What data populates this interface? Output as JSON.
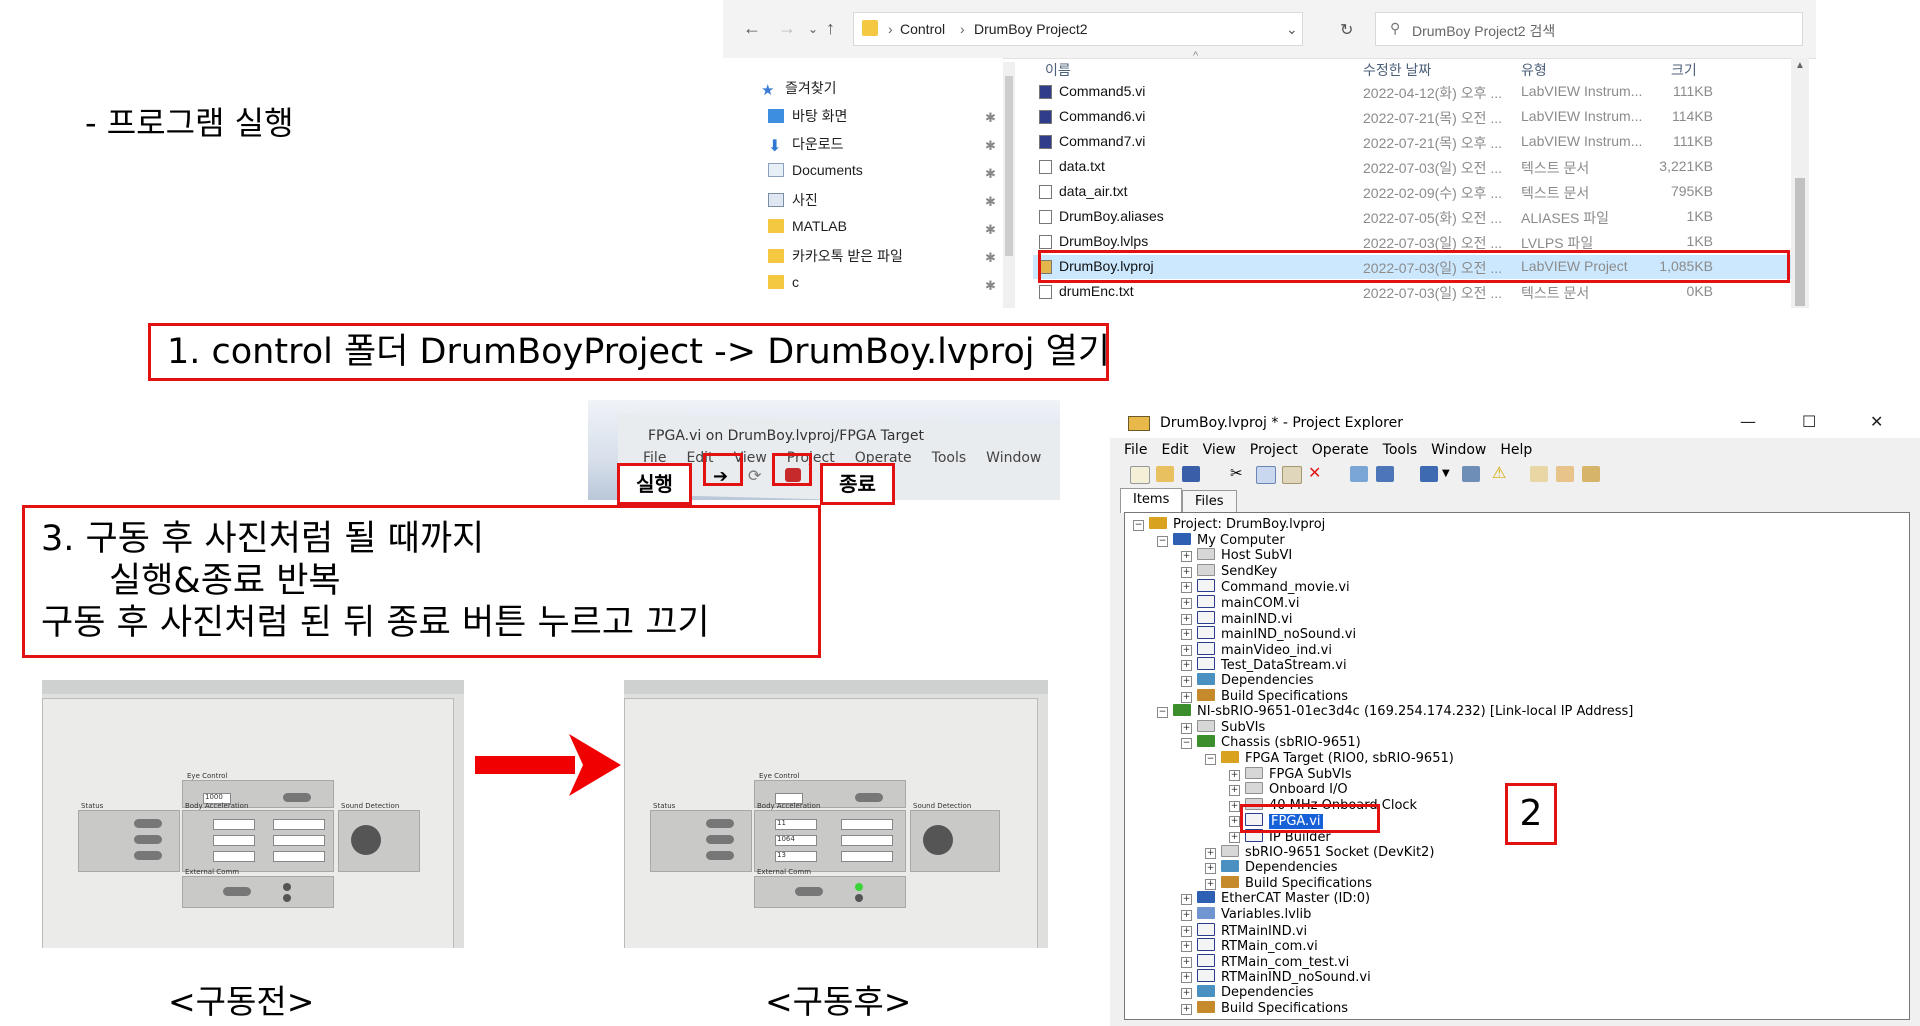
{
  "slide": {
    "heading": "- 프로그램 실행",
    "step1": "1. control 폴더 DrumBoyProject -> DrumBoy.lvproj 열기",
    "step3_lines": [
      "3. 구동 후 사진처럼 될 때까지",
      "실행&종료 반복",
      "구동 후 사진처럼 된 뒤 종료 버튼 누르고 끄기"
    ],
    "step2_label": "2",
    "caption_before": "<구동전>",
    "caption_after": "<구동후>",
    "accent_color": "#e31212"
  },
  "explorer": {
    "path": [
      "Control",
      "DrumBoy Project2"
    ],
    "search_placeholder": "DrumBoy Project2 검색",
    "sort_column": "이름",
    "columns": [
      "이름",
      "수정한 날짜",
      "유형",
      "크기"
    ],
    "nav_items": [
      {
        "label": "즐겨찾기",
        "icon": "star-icon"
      },
      {
        "label": "바탕 화면",
        "icon": "desktop-icon"
      },
      {
        "label": "다운로드",
        "icon": "download-icon"
      },
      {
        "label": "Documents",
        "icon": "document-icon"
      },
      {
        "label": "사진",
        "icon": "picture-icon"
      },
      {
        "label": "MATLAB",
        "icon": "folder-icon"
      },
      {
        "label": "카카오톡 받은 파일",
        "icon": "folder-icon"
      },
      {
        "label": "c",
        "icon": "folder-icon"
      }
    ],
    "files": [
      {
        "name": "Command5.vi",
        "date": "2022-04-12(화) 오후 ...",
        "type": "LabVIEW Instrum...",
        "size": "111KB",
        "icon": "labview-vi-icon"
      },
      {
        "name": "Command6.vi",
        "date": "2022-07-21(목) 오전 ...",
        "type": "LabVIEW Instrum...",
        "size": "114KB",
        "icon": "labview-vi-icon"
      },
      {
        "name": "Command7.vi",
        "date": "2022-07-21(목) 오후 ...",
        "type": "LabVIEW Instrum...",
        "size": "111KB",
        "icon": "labview-vi-icon"
      },
      {
        "name": "data.txt",
        "date": "2022-07-03(일) 오전 ...",
        "type": "텍스트 문서",
        "size": "3,221KB",
        "icon": "text-file-icon"
      },
      {
        "name": "data_air.txt",
        "date": "2022-02-09(수) 오후 ...",
        "type": "텍스트 문서",
        "size": "795KB",
        "icon": "text-file-icon"
      },
      {
        "name": "DrumBoy.aliases",
        "date": "2022-07-05(화) 오전 ...",
        "type": "ALIASES 파일",
        "size": "1KB",
        "icon": "file-icon"
      },
      {
        "name": "DrumBoy.lvlps",
        "date": "2022-07-03(일) 오전 ...",
        "type": "LVLPS 파일",
        "size": "1KB",
        "icon": "file-icon"
      },
      {
        "name": "DrumBoy.lvproj",
        "date": "2022-07-03(일) 오전 ...",
        "type": "LabVIEW Project",
        "size": "1,085KB",
        "icon": "labview-project-icon"
      },
      {
        "name": "drumEnc.txt",
        "date": "2022-07-03(일) 오전 ...",
        "type": "텍스트 문서",
        "size": "0KB",
        "icon": "text-file-icon"
      }
    ],
    "highlighted_file": "DrumBoy.lvproj"
  },
  "toolbar_photo": {
    "title": "FPGA.vi on DrumBoy.lvproj/FPGA Target",
    "menu": [
      "File",
      "Edit",
      "View",
      "Project",
      "Operate",
      "Tools",
      "Window"
    ],
    "run_label": "실행",
    "stop_label": "종료"
  },
  "panel_photos": {
    "labels": [
      "Eye Control",
      "Status",
      "Body Acceleration",
      "Sound Detection",
      "External Comm"
    ],
    "before_values": [
      "1000",
      "0",
      "0",
      "0"
    ],
    "after_values": [
      "11",
      "1064",
      "13"
    ]
  },
  "project_explorer": {
    "title": "DrumBoy.lvproj * - Project Explorer",
    "menu": [
      "File",
      "Edit",
      "View",
      "Project",
      "Operate",
      "Tools",
      "Window",
      "Help"
    ],
    "tabs": [
      "Items",
      "Files"
    ],
    "tree": [
      {
        "label": "Project: DrumBoy.lvproj",
        "depth": 0,
        "icon": "project-icon"
      },
      {
        "label": "My Computer",
        "depth": 1,
        "icon": "computer-icon"
      },
      {
        "label": "Host SubVI",
        "depth": 2,
        "icon": "folder-icon"
      },
      {
        "label": "SendKey",
        "depth": 2,
        "icon": "folder-icon"
      },
      {
        "label": "Command_movie.vi",
        "depth": 2,
        "icon": "vi-icon"
      },
      {
        "label": "mainCOM.vi",
        "depth": 2,
        "icon": "vi-icon"
      },
      {
        "label": "mainIND.vi",
        "depth": 2,
        "icon": "vi-icon"
      },
      {
        "label": "mainIND_noSound.vi",
        "depth": 2,
        "icon": "vi-icon"
      },
      {
        "label": "mainVideo_ind.vi",
        "depth": 2,
        "icon": "vi-icon"
      },
      {
        "label": "Test_DataStream.vi",
        "depth": 2,
        "icon": "vi-icon"
      },
      {
        "label": "Dependencies",
        "depth": 2,
        "icon": "dependencies-icon"
      },
      {
        "label": "Build Specifications",
        "depth": 2,
        "icon": "build-icon"
      },
      {
        "label": "NI-sbRIO-9651-01ec3d4c (169.254.174.232) [Link-local IP Address]",
        "depth": 1,
        "icon": "target-icon"
      },
      {
        "label": "SubVIs",
        "depth": 2,
        "icon": "folder-icon"
      },
      {
        "label": "Chassis (sbRIO-9651)",
        "depth": 2,
        "icon": "chassis-icon"
      },
      {
        "label": "FPGA Target (RIO0, sbRIO-9651)",
        "depth": 3,
        "icon": "fpga-icon"
      },
      {
        "label": "FPGA SubVIs",
        "depth": 4,
        "icon": "folder-icon"
      },
      {
        "label": "Onboard I/O",
        "depth": 4,
        "icon": "folder-icon"
      },
      {
        "label": "40 MHz Onboard Clock",
        "depth": 4,
        "icon": "clock-icon"
      },
      {
        "label": "FPGA.vi",
        "depth": 4,
        "icon": "vi-icon"
      },
      {
        "label": "IP Builder",
        "depth": 4,
        "icon": "vi-icon"
      },
      {
        "label": "sbRIO-9651 Socket (DevKit2)",
        "depth": 3,
        "icon": "socket-icon"
      },
      {
        "label": "Dependencies",
        "depth": 3,
        "icon": "dependencies-icon"
      },
      {
        "label": "Build Specifications",
        "depth": 3,
        "icon": "build-icon"
      },
      {
        "label": "EtherCAT Master (ID:0)",
        "depth": 2,
        "icon": "ethercat-icon"
      },
      {
        "label": "Variables.lvlib",
        "depth": 2,
        "icon": "library-icon"
      },
      {
        "label": "RTMainIND.vi",
        "depth": 2,
        "icon": "vi-icon"
      },
      {
        "label": "RTMain_com.vi",
        "depth": 2,
        "icon": "vi-icon"
      },
      {
        "label": "RTMain_com_test.vi",
        "depth": 2,
        "icon": "vi-icon"
      },
      {
        "label": "RTMainIND_noSound.vi",
        "depth": 2,
        "icon": "vi-icon"
      },
      {
        "label": "Dependencies",
        "depth": 2,
        "icon": "dependencies-icon"
      },
      {
        "label": "Build Specifications",
        "depth": 2,
        "icon": "build-icon"
      }
    ],
    "selected_item": "FPGA.vi"
  }
}
